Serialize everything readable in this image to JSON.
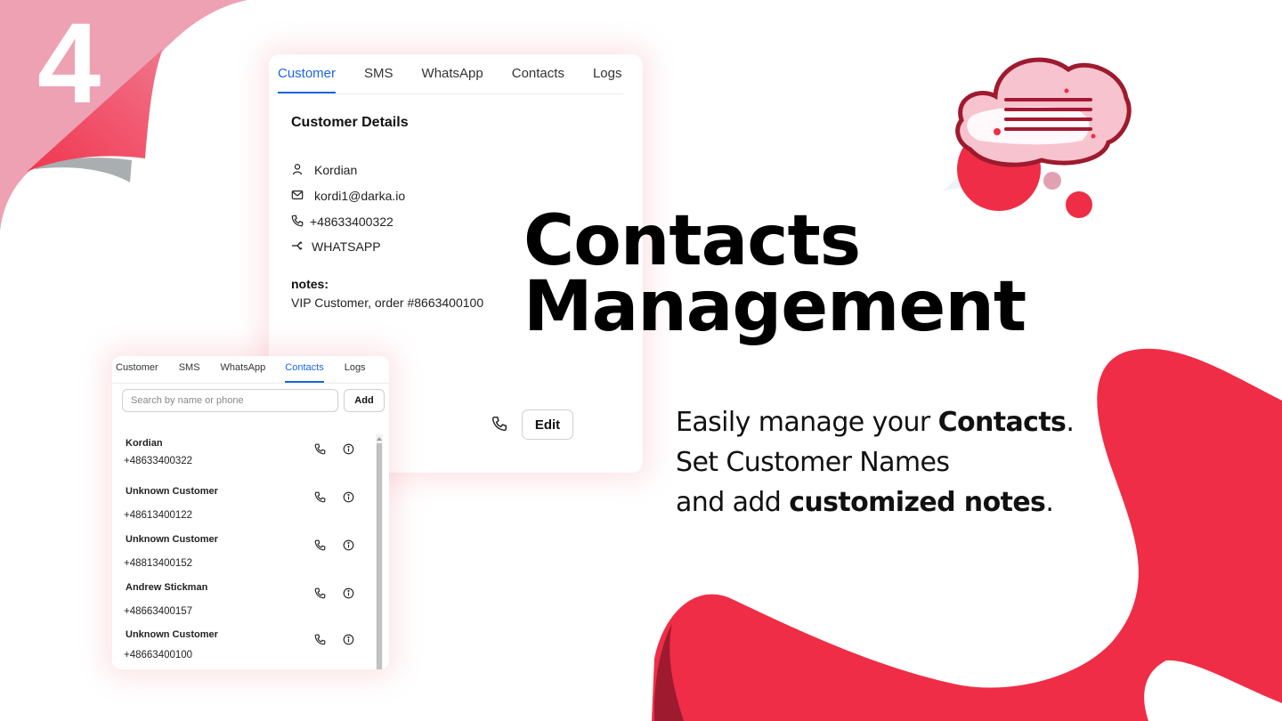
{
  "slide": {
    "step_number": "4",
    "headline": {
      "line1": "Contacts",
      "line2": "Management"
    },
    "subtext": {
      "line1_prefix": "Easily manage your ",
      "line1_bold": "Contacts",
      "line1_suffix": ".",
      "line2": "Set Customer Names",
      "line3_prefix": "and add ",
      "line3_bold": "customized notes",
      "line3_suffix": "."
    },
    "colors": {
      "brand_red": "#f02d46",
      "dark_red": "#9e1a2e",
      "pink": "#eea1b3",
      "tab_active_blue": "#1a66e6"
    },
    "decor_icons": [
      "page-curl-icon",
      "chat-cloud-icon"
    ]
  },
  "customer_panel": {
    "tabs": [
      {
        "label": "Customer",
        "active": true
      },
      {
        "label": "SMS",
        "active": false
      },
      {
        "label": "WhatsApp",
        "active": false
      },
      {
        "label": "Contacts",
        "active": false
      },
      {
        "label": "Logs",
        "active": false
      }
    ],
    "title": "Customer Details",
    "details": {
      "name": {
        "icon": "user-icon",
        "value": "Kordian"
      },
      "email": {
        "icon": "mail-icon",
        "value": "kordi1@darka.io"
      },
      "phone": {
        "icon": "phone-icon",
        "value": "+48633400322"
      },
      "channel": {
        "icon": "share-icon",
        "value": "WHATSAPP"
      }
    },
    "notes_label": "notes:",
    "notes_value": "VIP Customer, order #8663400100",
    "edit_label": "Edit"
  },
  "contacts_panel": {
    "tabs": [
      {
        "label": "Customer",
        "active": false
      },
      {
        "label": "SMS",
        "active": false
      },
      {
        "label": "WhatsApp",
        "active": false
      },
      {
        "label": "Contacts",
        "active": true
      },
      {
        "label": "Logs",
        "active": false
      }
    ],
    "search": {
      "placeholder": "Search by name or phone",
      "value": ""
    },
    "add_label": "Add",
    "contacts": [
      {
        "name": "Kordian",
        "phone": "+48633400322"
      },
      {
        "name": "Unknown Customer",
        "phone": "+48613400122"
      },
      {
        "name": "Unknown Customer",
        "phone": "+48813400152"
      },
      {
        "name": "Andrew Stickman",
        "phone": "+48663400157"
      },
      {
        "name": "Unknown Customer",
        "phone": "+48663400100"
      }
    ]
  }
}
